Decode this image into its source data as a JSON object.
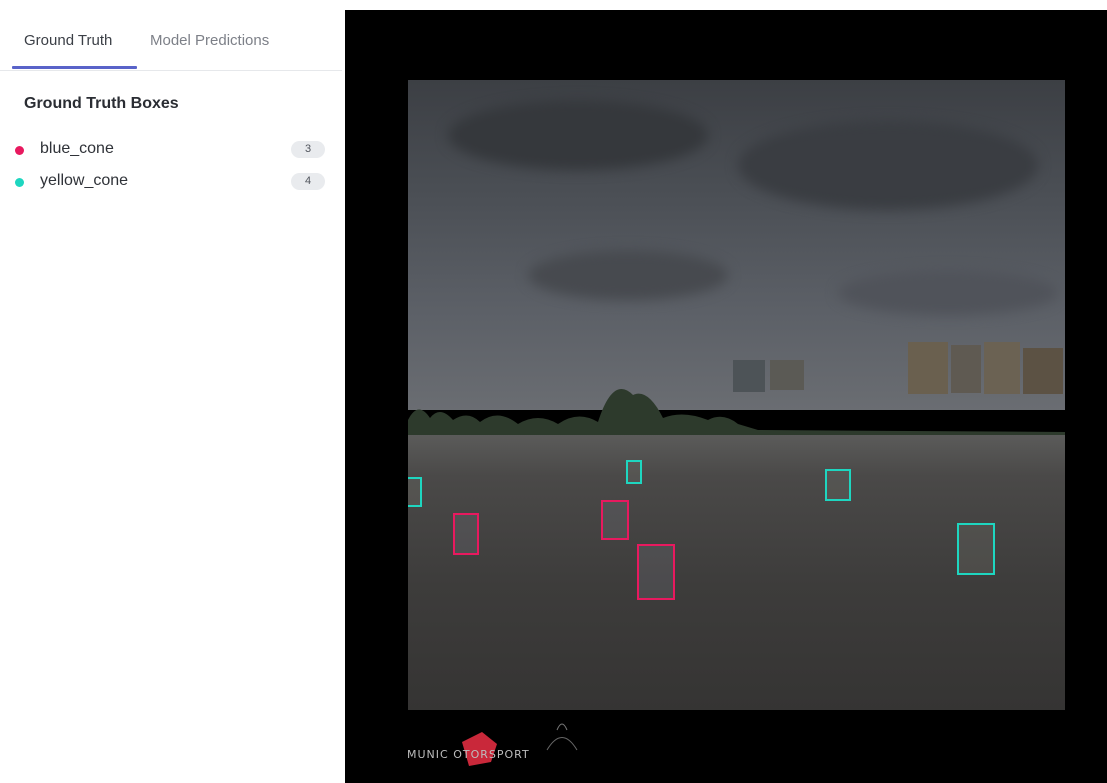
{
  "tabs": [
    {
      "label": "Ground Truth",
      "active": true
    },
    {
      "label": "Model Predictions",
      "active": false
    }
  ],
  "section_title": "Ground Truth Boxes",
  "classes": [
    {
      "label": "blue_cone",
      "count": "3",
      "color": "#e8195f"
    },
    {
      "label": "yellow_cone",
      "count": "4",
      "color": "#1ed6c0"
    }
  ],
  "colors": {
    "accent": "#5963c9",
    "blue_cone_box": "#e8195f",
    "yellow_cone_box": "#1ed6c0",
    "viewer_background": "#000000"
  },
  "viewer": {
    "watermark_text": "MUNICH MOTORSPORT",
    "watermark_visible_text": "MUNIC  OTORSPORT"
  }
}
